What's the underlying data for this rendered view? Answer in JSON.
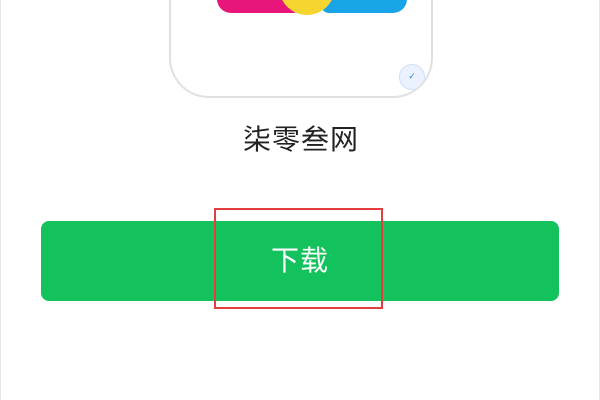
{
  "app": {
    "name": "柒零叁网",
    "icon_name": "app-logo-icon",
    "badge_icon_name": "corner-badge-icon"
  },
  "download": {
    "label": "下载"
  },
  "colors": {
    "button_green": "#13c25c",
    "highlight_red": "#e43d3d",
    "logo_magenta": "#e8157a",
    "logo_yellow": "#f7d531",
    "logo_blue": "#18a4e6"
  }
}
